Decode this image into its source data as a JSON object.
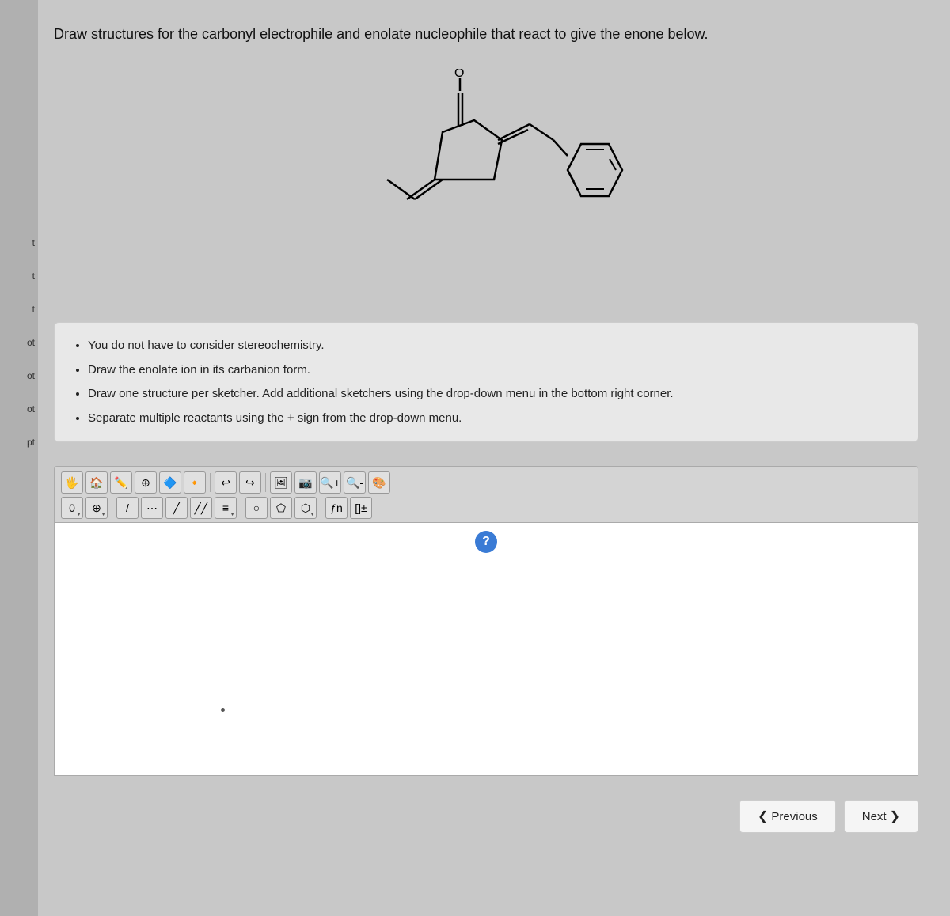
{
  "page": {
    "question_title": "Draw structures for the carbonyl electrophile and enolate nucleophile that react to give the enone below.",
    "instructions": [
      {
        "text": "You do ",
        "highlight": "not",
        "rest": " have to consider stereochemistry."
      },
      {
        "text": "Draw the enolate ion in its carbanion form.",
        "highlight": null,
        "rest": null
      },
      {
        "text": "Draw one structure per sketcher. Add additional sketchers using the drop-down menu in the bottom right corner.",
        "highlight": null,
        "rest": null
      },
      {
        "text": "Separate multiple reactants using the + sign from the drop-down menu.",
        "highlight": null,
        "rest": null
      }
    ],
    "sidebar_labels": [
      "t",
      "t",
      "t",
      "ot",
      "ot",
      "ot",
      "pt"
    ],
    "toolbar": {
      "row1_tools": [
        "hand",
        "eraser",
        "pencil",
        "globe",
        "structure",
        "structure2",
        "undo",
        "redo",
        "image",
        "camera",
        "zoom-in",
        "zoom-out",
        "color"
      ],
      "row2_tools": [
        "zero",
        "plus-circle",
        "line",
        "dotted-line",
        "single-bond",
        "double-bond",
        "triple-bond",
        "circle",
        "pentagon",
        "hexagon",
        "function",
        "bracket"
      ]
    },
    "question_mark_label": "?",
    "nav": {
      "previous_label": "Previous",
      "next_label": "Next"
    }
  }
}
